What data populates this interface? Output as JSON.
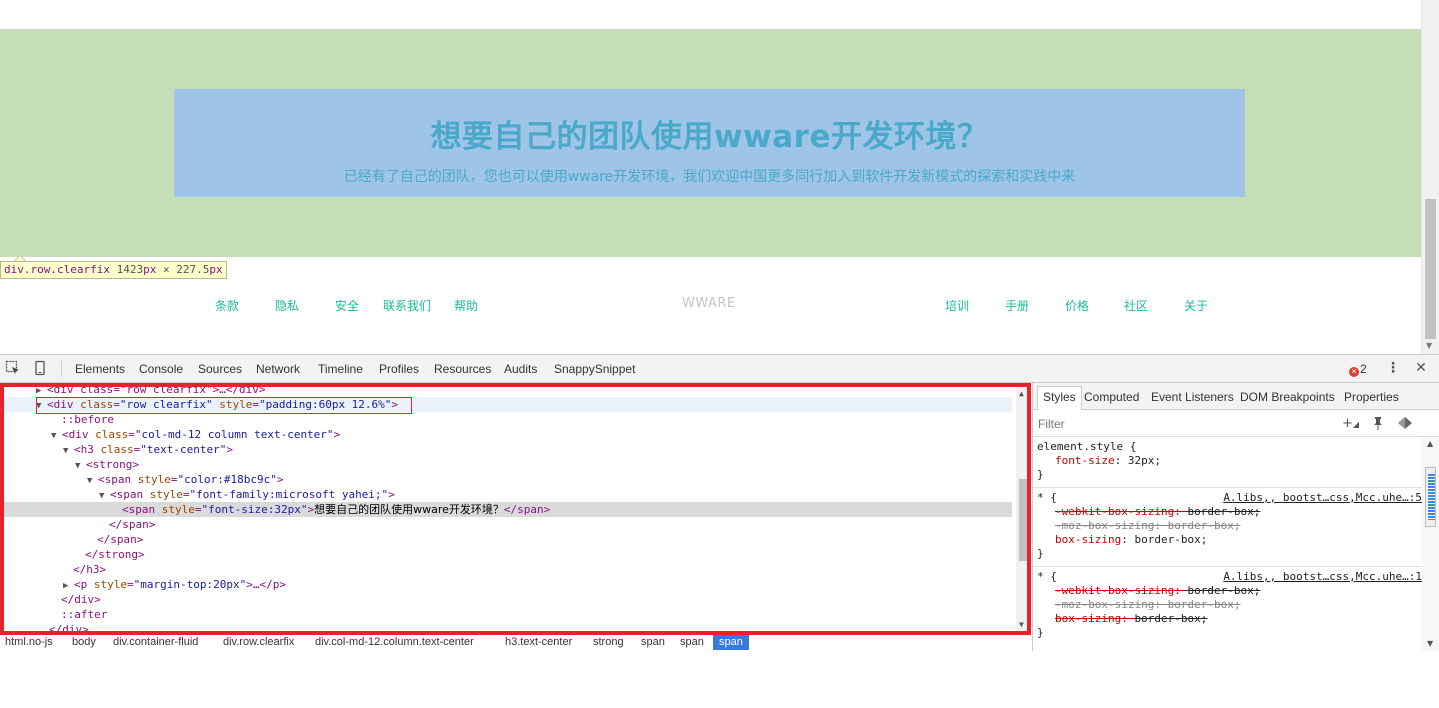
{
  "page": {
    "hero_title": "想要自己的团队使用wware开发环境？",
    "hero_subtitle": "已经有了自己的团队，您也可以使用wware开发环境，我们欢迎中国更多同行加入到软件开发新模式的探索和实践中来",
    "tooltip": {
      "selector": "div.row.clearfix",
      "width": "1423",
      "unit": "px",
      "times": " × ",
      "height": "227.5",
      "unit2": "px"
    },
    "footer_left": [
      "条款",
      "隐私",
      "安全",
      "联系我们",
      "帮助"
    ],
    "footer_brand": "WWARE",
    "footer_right": [
      "培训",
      "手册",
      "价格",
      "社区",
      "关于"
    ]
  },
  "devtools": {
    "tabs": [
      "Elements",
      "Console",
      "Sources",
      "Network",
      "Timeline",
      "Profiles",
      "Resources",
      "Audits",
      "SnappySnippet"
    ],
    "error_count": "2",
    "dom": {
      "line0": "<div class=\"row clearfix\">…</div>",
      "line1_tag": "div",
      "line1_attr1": "class",
      "line1_val1": "\"row clearfix\"",
      "line1_attr2": "style",
      "line1_val2": "\"padding:60px 12.6%\"",
      "line2": "::before",
      "line3_tag": "div",
      "line3_attr": "class",
      "line3_val": "\"col-md-12 column text-center\"",
      "line4_tag": "h3",
      "line4_attr": "class",
      "line4_val": "\"text-center\"",
      "line5": "<strong>",
      "line6_tag": "span",
      "line6_attr": "style",
      "line6_val": "\"color:#18bc9c\"",
      "line7_tag": "span",
      "line7_attr": "style",
      "line7_val": "\"font-family:microsoft yahei;\"",
      "line8_tag": "span",
      "line8_attr": "style",
      "line8_val": "\"font-size:32px\"",
      "line8_text": "想要自己的团队使用wware开发环境？",
      "line8_close": "</span>",
      "line9": "</span>",
      "line10": "</span>",
      "line11": "</strong>",
      "line12": "</h3>",
      "line13_tag": "p",
      "line13_attr": "style",
      "line13_val": "\"margin-top:20px\"",
      "line13_rest": ">…</p>",
      "line14": "</div>",
      "line15": "::after",
      "line16": "</div>"
    },
    "breadcrumbs": [
      "html.no-js",
      "body",
      "div.container-fluid",
      "div.row.clearfix",
      "div.col-md-12.column.text-center",
      "h3.text-center",
      "strong",
      "span",
      "span",
      "span"
    ],
    "sidebar": {
      "tabs": [
        "Styles",
        "Computed",
        "Event Listeners",
        "DOM Breakpoints",
        "Properties"
      ],
      "filter_placeholder": "Filter",
      "rule1": {
        "selector": "element.style {",
        "prop": "font-size",
        "value": "32px;",
        "close": "}"
      },
      "rule2": {
        "selector": "* {",
        "source": "A.libs,, bootst…css,Mcc.uhe…:5",
        "p1": "-webkit-box-sizing",
        "v1": "border-box;",
        "p2": "-moz-box-sizing",
        "v2": "border-box;",
        "p3": "box-sizing",
        "v3": "border-box;",
        "close": "}"
      },
      "rule3": {
        "selector": "* {",
        "source": "A.libs,, bootst…css,Mcc.uhe…:1",
        "p1": "-webkit-box-sizing",
        "v1": "border-box;",
        "p2": "-moz-box-sizing",
        "v2": "border-box;",
        "p3": "box-sizing",
        "v3": "border-box;",
        "close": "}"
      }
    }
  },
  "colors": {
    "highlight_green": "#c4dfb8",
    "highlight_blue": "#9ec4e8",
    "accent": "#18bc9c",
    "inspect_red": "#e8212a"
  }
}
